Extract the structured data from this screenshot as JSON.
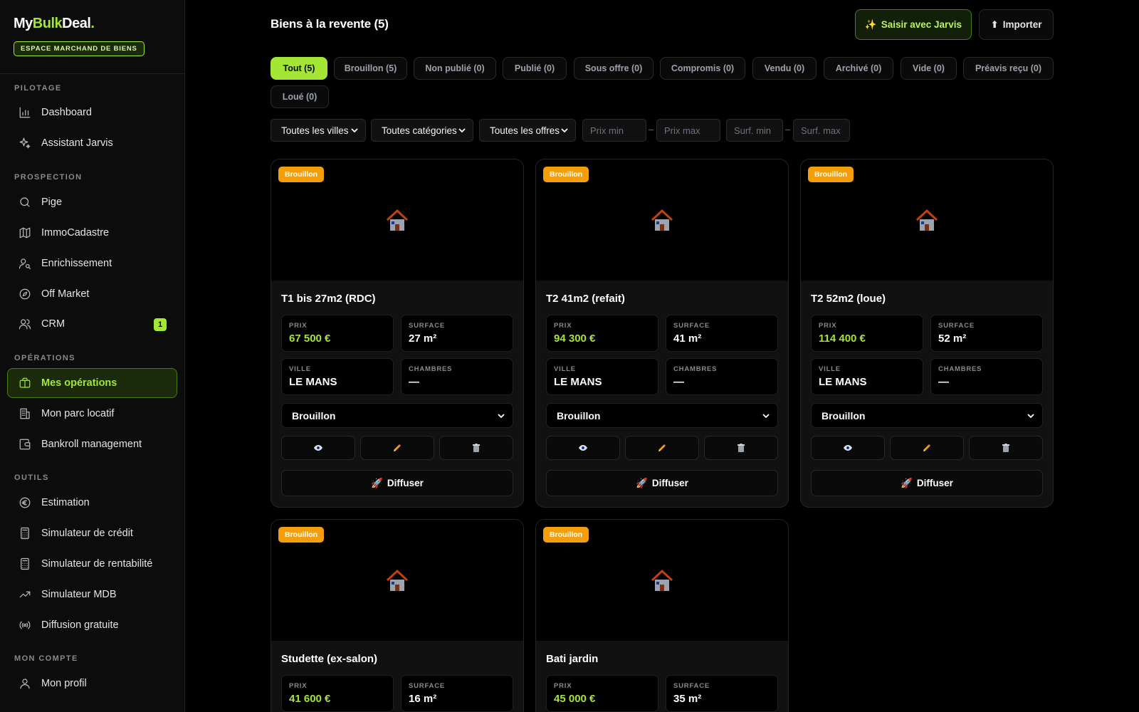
{
  "brand": {
    "name_a": "My",
    "name_b": "Bulk",
    "name_c": "Deal",
    "name_dot": ".",
    "space_label": "ESPACE MARCHAND DE BIENS"
  },
  "sidebar": {
    "sections": [
      {
        "title": "PILOTAGE"
      },
      {
        "title": "PROSPECTION"
      },
      {
        "title": "OPÉRATIONS"
      },
      {
        "title": "OUTILS"
      },
      {
        "title": "MON COMPTE"
      }
    ],
    "items": [
      {
        "label": "Dashboard",
        "icon": "bar-chart-icon"
      },
      {
        "label": "Assistant Jarvis",
        "icon": "sparkles-icon"
      },
      {
        "label": "Pige",
        "icon": "search-icon"
      },
      {
        "label": "ImmoCadastre",
        "icon": "map-icon"
      },
      {
        "label": "Enrichissement",
        "icon": "user-search-icon"
      },
      {
        "label": "Off Market",
        "icon": "compass-icon"
      },
      {
        "label": "CRM",
        "icon": "users-icon",
        "count": "1"
      },
      {
        "label": "Mes opérations",
        "icon": "briefcase-icon",
        "active": true
      },
      {
        "label": "Mon parc locatif",
        "icon": "building-icon"
      },
      {
        "label": "Bankroll management",
        "icon": "wallet-icon"
      },
      {
        "label": "Estimation",
        "icon": "euro-icon"
      },
      {
        "label": "Simulateur de crédit",
        "icon": "calculator-icon"
      },
      {
        "label": "Simulateur de rentabilité",
        "icon": "calculator-icon"
      },
      {
        "label": "Simulateur MDB",
        "icon": "trending-up-icon"
      },
      {
        "label": "Diffusion gratuite",
        "icon": "broadcast-icon"
      },
      {
        "label": "Mon profil",
        "icon": "user-icon"
      }
    ]
  },
  "header": {
    "title": "Biens à la revente (5)",
    "jarvis_icon": "✨",
    "jarvis_label": "Saisir avec Jarvis",
    "import_icon": "⬆",
    "import_label": "Importer"
  },
  "tabs": [
    {
      "label": "Tout (5)",
      "active": true
    },
    {
      "label": "Brouillon (5)"
    },
    {
      "label": "Non publié (0)"
    },
    {
      "label": "Publié (0)"
    },
    {
      "label": "Sous offre (0)"
    },
    {
      "label": "Compromis (0)"
    },
    {
      "label": "Vendu (0)"
    },
    {
      "label": "Archivé (0)"
    },
    {
      "label": "Vide (0)"
    },
    {
      "label": "Préavis reçu (0)"
    },
    {
      "label": "Loué (0)"
    }
  ],
  "filters": {
    "city": "Toutes les villes",
    "category": "Toutes catégories",
    "offer": "Toutes les offres",
    "price_min_placeholder": "Prix min",
    "price_max_placeholder": "Prix max",
    "surf_min_placeholder": "Surf. min",
    "surf_max_placeholder": "Surf. max",
    "separator": "–"
  },
  "labels": {
    "price": "PRIX",
    "surface": "SURFACE",
    "city": "VILLE",
    "rooms": "CHAMBRES",
    "diffuse": "Diffuser",
    "diffuse_icon": "🚀"
  },
  "colors": {
    "accent": "#a3e635",
    "draft_badge": "#f59e0b"
  },
  "properties": [
    {
      "title": "T1 bis 27m2 (RDC)",
      "badge": "Brouillon",
      "price": "67 500 €",
      "surface": "27 m²",
      "city": "LE MANS",
      "rooms": "—",
      "status": "Brouillon"
    },
    {
      "title": "T2 41m2 (refait)",
      "badge": "Brouillon",
      "price": "94 300 €",
      "surface": "41 m²",
      "city": "LE MANS",
      "rooms": "—",
      "status": "Brouillon"
    },
    {
      "title": "T2 52m2 (loue)",
      "badge": "Brouillon",
      "price": "114 400 €",
      "surface": "52 m²",
      "city": "LE MANS",
      "rooms": "—",
      "status": "Brouillon"
    },
    {
      "title": "Studette (ex-salon)",
      "badge": "Brouillon",
      "price": "41 600 €",
      "surface": "16 m²"
    },
    {
      "title": "Bati jardin",
      "badge": "Brouillon",
      "price": "45 000 €",
      "surface": "35 m²"
    }
  ]
}
